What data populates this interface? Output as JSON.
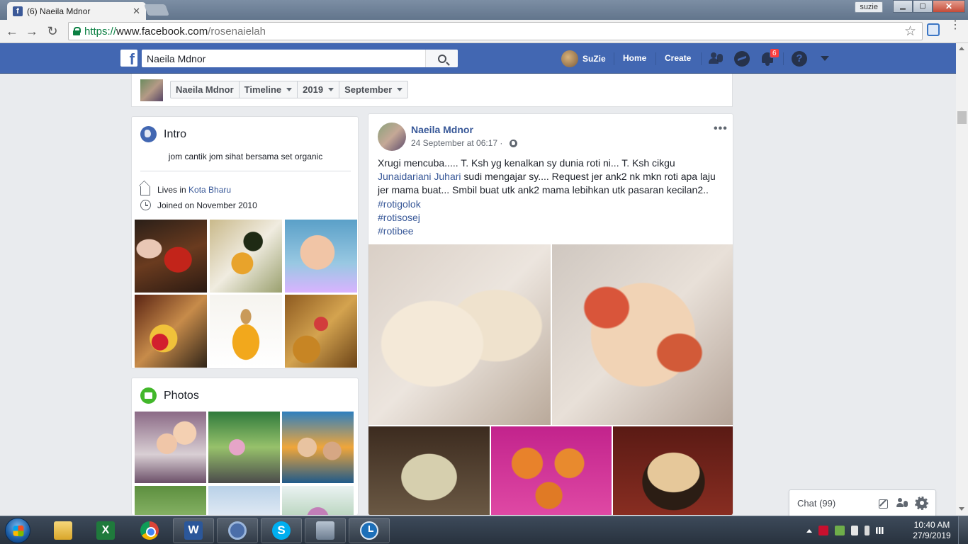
{
  "browser": {
    "tab": {
      "title": "(6) Naeila Mdnor",
      "close_glyph": "✕",
      "favicon_letter": "f"
    },
    "user_chip": "suzie",
    "window_buttons": {
      "minimize": "▁",
      "maximize": "▢",
      "close": "✕"
    },
    "nav": {
      "back": "←",
      "forward": "→",
      "reload": "↻"
    },
    "url": {
      "scheme": "https://",
      "host": "www.facebook.com",
      "path": "/rosenaielah"
    },
    "star_glyph": "☆",
    "menu_glyph": "⋮"
  },
  "fb": {
    "logo": "f",
    "search_value": "Naeila Mdnor",
    "user_name": "SuZie",
    "home_label": "Home",
    "create_label": "Create",
    "notifications_count": "6",
    "help_glyph": "?"
  },
  "timeline_nav": {
    "buttons": [
      {
        "label": "Naeila Mdnor",
        "dropdown": false
      },
      {
        "label": "Timeline",
        "dropdown": true
      },
      {
        "label": "2019",
        "dropdown": true
      },
      {
        "label": "September",
        "dropdown": true
      }
    ]
  },
  "intro": {
    "title": "Intro",
    "bio": "jom cantik jom sihat bersama set organic",
    "lives_prefix": "Lives in ",
    "lives_place": "Kota Bharu",
    "joined": "Joined on November 2010"
  },
  "photos": {
    "title": "Photos"
  },
  "post": {
    "author": "Naeila Mdnor",
    "timestamp": "24 September at 06:17 · ",
    "more_glyph": "•••",
    "text_1": "Xrugi mencuba..... T. Ksh yg kenalkan sy dunia roti ni... T. Ksh cikgu ",
    "mention": "Junaidariani Juhari",
    "text_2": " sudi mengajar sy.... Request jer ank2 nk mkn roti apa laju jer mama buat... Smbil buat utk ank2 mama lebihkan utk pasaran kecilan2..",
    "hashtags": [
      "#rotigolok",
      "#rotisosej",
      "#rotibee"
    ]
  },
  "chat": {
    "label": "Chat (99)"
  },
  "taskbar": {
    "apps": [
      "explorer",
      "excel",
      "chrome",
      "word",
      "chrome-profile",
      "skype",
      "remote-desktop",
      "clock"
    ],
    "excel_letter": "X",
    "word_letter": "W",
    "skype_letter": "S",
    "time": "10:40 AM",
    "date": "27/9/2019"
  }
}
